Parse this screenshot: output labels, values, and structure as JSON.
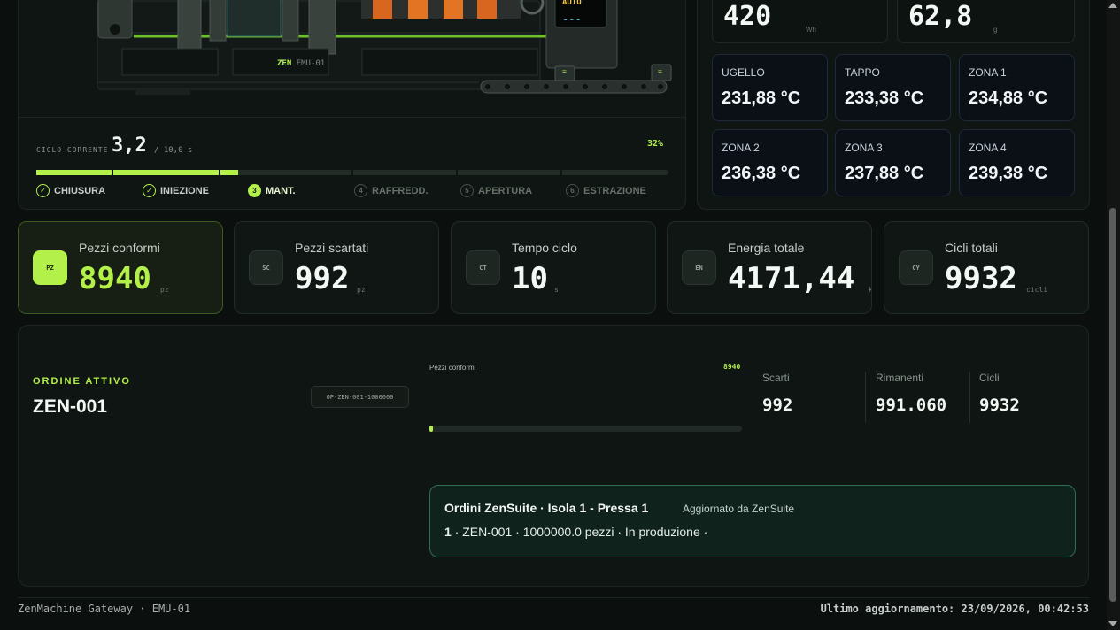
{
  "machine": {
    "mode_label": "AUTO",
    "mode_value": "---",
    "brand_label": "ZEN",
    "model_label": "EMU-01",
    "indicator_a": "=",
    "indicator_b": "=",
    "cycle_label": "CICLO CORRENTE",
    "cycle_value": "3,2",
    "cycle_max": "/ 10,0 s",
    "cycle_percent": "32%",
    "cycle_fraction": 0.32,
    "steps": [
      {
        "num": "✓",
        "label": "CHIUSURA",
        "state": "done"
      },
      {
        "num": "✓",
        "label": "INIEZIONE",
        "state": "done"
      },
      {
        "num": "3",
        "label": "MANT.",
        "state": "active"
      },
      {
        "num": "4",
        "label": "RAFFREDD.",
        "state": "pending"
      },
      {
        "num": "5",
        "label": "APERTURA",
        "state": "pending"
      },
      {
        "num": "6",
        "label": "ESTRAZIONE",
        "state": "pending"
      }
    ]
  },
  "sensors": {
    "energy_cycle": {
      "value": "420",
      "unit": "Wh"
    },
    "shot_weight": {
      "value": "62,8",
      "unit": "g"
    },
    "temps": [
      {
        "label": "UGELLO",
        "value": "231,88 °C"
      },
      {
        "label": "TAPPO",
        "value": "233,38 °C"
      },
      {
        "label": "ZONA 1",
        "value": "234,88 °C"
      },
      {
        "label": "ZONA 2",
        "value": "236,38 °C"
      },
      {
        "label": "ZONA 3",
        "value": "237,88 °C"
      },
      {
        "label": "ZONA 4",
        "value": "239,38 °C"
      }
    ]
  },
  "kpis": [
    {
      "icon": "PZ",
      "title": "Pezzi conformi",
      "value": "8940",
      "unit": "pz"
    },
    {
      "icon": "SC",
      "title": "Pezzi scartati",
      "value": "992",
      "unit": "pz"
    },
    {
      "icon": "CT",
      "title": "Tempo ciclo",
      "value": "10",
      "unit": "s"
    },
    {
      "icon": "EN",
      "title": "Energia totale",
      "value": "4171,44",
      "unit": "kWh"
    },
    {
      "icon": "CY",
      "title": "Cicli totali",
      "value": "9932",
      "unit": "cicli"
    }
  ],
  "order": {
    "section_label": "ORDINE ATTIVO",
    "code": "ZEN-001",
    "chip": "OP-ZEN-001-1000000",
    "progress_title": "Pezzi conformi",
    "progress_value": "8940",
    "progress_fraction": 0.00894,
    "stats": [
      {
        "label": "Scarti",
        "value": "992"
      },
      {
        "label": "Rimanenti",
        "value": "991.060"
      },
      {
        "label": "Cicli",
        "value": "9932"
      }
    ],
    "zensuite": {
      "title": "Ordini ZenSuite · Isola 1 - Pressa 1",
      "subtitle": "Aggiornato da ZenSuite",
      "line_num": "1",
      "line_text": " · ZEN-001 · 1000000.0 pezzi · In produzione ·"
    }
  },
  "footer": {
    "left": "ZenMachine Gateway · EMU-01",
    "right": "Ultimo aggiornamento: 23/09/2026, 00:42:53"
  },
  "colors": {
    "accent": "#b4f04a",
    "background": "#0b0f0d",
    "zensuite_border": "#2f6d55"
  }
}
